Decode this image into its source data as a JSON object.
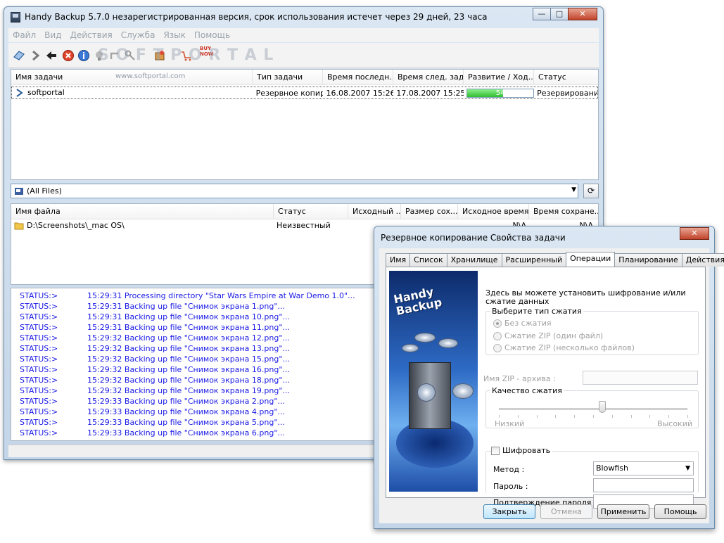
{
  "main_window": {
    "title": "Handy Backup 5.7.0 незарегистрированная версия, срок использования истечет через  29 дней, 23 часа",
    "controls": {
      "minimize": "—",
      "maximize": "□",
      "close": "✕"
    },
    "menu": [
      "Файл",
      "Вид",
      "Действия",
      "Служба",
      "Язык",
      "Помощь"
    ],
    "toolbar": {
      "icons": [
        "new-task-icon",
        "next-icon",
        "back-icon",
        "stop-icon",
        "info-icon",
        "wizard-icon",
        "restore-icon",
        "key-icon",
        "package-icon",
        "buy-now-icon"
      ],
      "buy_label": "BUY NOW",
      "watermark": "S O F T P O R T A L",
      "watermark_url": "www.softportal.com"
    },
    "tasks_table": {
      "columns": [
        "Имя задачи",
        "Тип задачи",
        "Время последн...",
        "Время след. задача",
        "Развитие / Ход...",
        "Статус"
      ],
      "rows": [
        {
          "name": "softportal",
          "type": "Резервное копир...",
          "last": "16.08.2007 15:26:...",
          "next": "17.08.2007 15:25:...",
          "progress": 54,
          "progress_label": "54",
          "status": "Резервирование"
        }
      ]
    },
    "filter": {
      "value": "(All Files)"
    },
    "files_table": {
      "columns": [
        "Имя файла",
        "Статус",
        "Исходный ...",
        "Размер сох...",
        "Исходное время",
        "Время сохране..."
      ],
      "rows": [
        {
          "name": "D:\\Screenshots\\_mac OS\\",
          "status": "Неизвестный",
          "src": "",
          "size": "",
          "src_time": "N\\A",
          "saved_time": "N\\A"
        }
      ]
    },
    "log": [
      {
        "label": "STATUS:>",
        "text": "15:29:31 Processing directory \"Star Wars Empire at War Demo 1.0\"..."
      },
      {
        "label": "STATUS:>",
        "text": "15:29:31 Backing up file \"Снимок экрана 1.png\"..."
      },
      {
        "label": "STATUS:>",
        "text": "15:29:31 Backing up file \"Снимок экрана 10.png\"..."
      },
      {
        "label": "STATUS:>",
        "text": "15:29:31 Backing up file \"Снимок экрана 11.png\"..."
      },
      {
        "label": "STATUS:>",
        "text": "15:29:32 Backing up file \"Снимок экрана 12.png\"..."
      },
      {
        "label": "STATUS:>",
        "text": "15:29:32 Backing up file \"Снимок экрана 13.png\"..."
      },
      {
        "label": "STATUS:>",
        "text": "15:29:32 Backing up file \"Снимок экрана 15.png\"..."
      },
      {
        "label": "STATUS:>",
        "text": "15:29:32 Backing up file \"Снимок экрана 16.png\"..."
      },
      {
        "label": "STATUS:>",
        "text": "15:29:32 Backing up file \"Снимок экрана 18.png\"..."
      },
      {
        "label": "STATUS:>",
        "text": "15:29:32 Backing up file \"Снимок экрана 19.png\"..."
      },
      {
        "label": "STATUS:>",
        "text": "15:29:33 Backing up file \"Снимок экрана 2.png\"..."
      },
      {
        "label": "STATUS:>",
        "text": "15:29:33 Backing up file \"Снимок экрана 4.png\"..."
      },
      {
        "label": "STATUS:>",
        "text": "15:29:33 Backing up file \"Снимок экрана 5.png\"..."
      },
      {
        "label": "STATUS:>",
        "text": "15:29:33 Backing up file \"Снимок экрана 6.png\"..."
      }
    ]
  },
  "dialog": {
    "title": "Резервное копирование Свойства задачи",
    "close": "✕",
    "tabs": [
      "Имя",
      "Список",
      "Хранилище",
      "Расширенный",
      "Операции",
      "Планирование",
      "Действия"
    ],
    "active_tab": "Операции",
    "art_logo": "Handy Backup",
    "intro": "Здесь вы можете установить шифрование и/или сжатие данных",
    "compression_group": "Выберите тип сжатия",
    "compression_options": [
      "Без сжатия",
      "Сжатие ZIP (один файл)",
      "Сжатие ZIP (несколько файлов)"
    ],
    "zip_name_label": "Имя ZIP - архива :",
    "zip_name_value": "",
    "quality_group": "Качество сжатия",
    "quality_level": 0.55,
    "quality_low": "Низкий",
    "quality_high": "Высокий",
    "encrypt_label": "Шифровать",
    "method_label": "Метод :",
    "method_value": "Blowfish",
    "password_label": "Пароль :",
    "password_value": "",
    "confirm_label": "Подтверждение пароля :",
    "confirm_value": "",
    "buttons": {
      "close": "Закрыть",
      "cancel": "Отмена",
      "apply": "Применить",
      "help": "Помощь"
    }
  },
  "colors": {
    "log_text": "#1a1ae6",
    "progress_fill": "#2fbd2f",
    "title_gradient_top": "#dbe7f3"
  }
}
